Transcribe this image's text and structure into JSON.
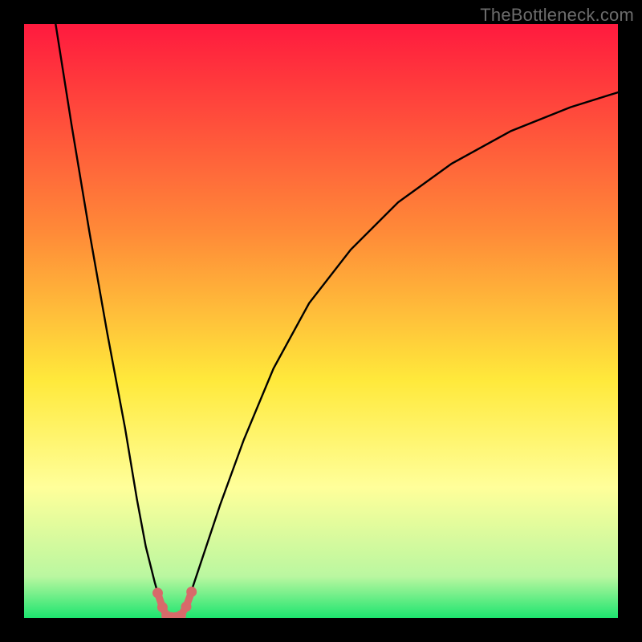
{
  "watermark": "TheBottleneck.com",
  "palette": {
    "black": "#000000",
    "curve": "#000000",
    "marker": "#d86a6a",
    "gradient": {
      "top": "#ff1a3e",
      "red": "#ff3a3c",
      "orange": "#ff9a35",
      "yellow": "#ffe93b",
      "paleYellow": "#ffff9a",
      "paleGreen": "#baf7a0",
      "green": "#1de56f"
    }
  },
  "chart_data": {
    "type": "line",
    "title": "",
    "xlabel": "",
    "ylabel": "",
    "xlim": [
      0,
      100
    ],
    "ylim": [
      0,
      100
    ],
    "series": [
      {
        "name": "left-branch",
        "x": [
          5,
          8,
          11,
          14,
          17,
          19,
          20.5,
          22,
          23,
          23.8,
          24.2
        ],
        "y": [
          102,
          83,
          65,
          48,
          32,
          20,
          12,
          6,
          2.5,
          0.8,
          0.2
        ]
      },
      {
        "name": "right-branch",
        "x": [
          25.8,
          26.5,
          28,
          30,
          33,
          37,
          42,
          48,
          55,
          63,
          72,
          82,
          92,
          100
        ],
        "y": [
          0.2,
          1,
          4,
          10,
          19,
          30,
          42,
          53,
          62,
          70,
          76.5,
          82,
          86,
          88.5
        ]
      }
    ],
    "markers": {
      "name": "valley-markers",
      "x": [
        22.5,
        23.3,
        24.0,
        24.8,
        25.6,
        26.4,
        27.3,
        28.2
      ],
      "y": [
        4.2,
        1.8,
        0.35,
        0.1,
        0.1,
        0.4,
        1.9,
        4.4
      ]
    },
    "gradient_bands": [
      {
        "y": 0,
        "color": "#ff1a3e"
      },
      {
        "y": 35,
        "color": "#ff8a38"
      },
      {
        "y": 60,
        "color": "#ffe93b"
      },
      {
        "y": 78,
        "color": "#ffff9a"
      },
      {
        "y": 93,
        "color": "#baf7a0"
      },
      {
        "y": 100,
        "color": "#1de56f"
      }
    ]
  }
}
